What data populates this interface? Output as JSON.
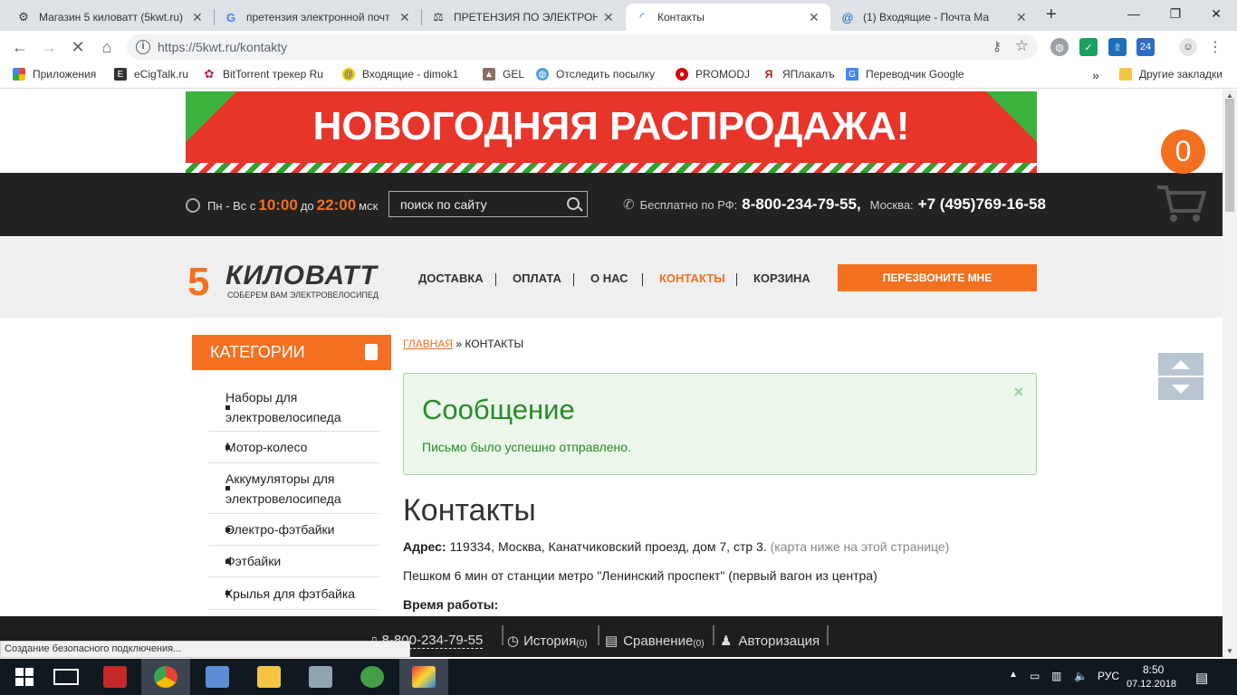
{
  "browser": {
    "tabs": [
      {
        "title": "Магазин 5 киловатт (5kwt.ru)",
        "icon": "film-icon"
      },
      {
        "title": "претензия электронной почт",
        "icon": "google-icon"
      },
      {
        "title": "ПРЕТЕНЗИЯ ПО ЭЛЕКТРОННО",
        "icon": "scales-icon"
      },
      {
        "title": "Контакты",
        "icon": "loading-icon"
      },
      {
        "title": "(1) Входящие - Почта Ма",
        "icon": "mail-at-icon"
      }
    ],
    "new_tab": "+",
    "url": "https://5kwt.ru/kontakty",
    "bookmarks": [
      {
        "label": "Приложения",
        "icon": "apps-grid-icon"
      },
      {
        "label": "eCigTalk.ru",
        "icon": "e-icon"
      },
      {
        "label": "BitTorrent трекер Ru",
        "icon": "flower-icon"
      },
      {
        "label": "Входящие - dimok1",
        "icon": "mail-at-icon"
      },
      {
        "label": "GEL",
        "icon": "gel-icon"
      },
      {
        "label": "Отследить посылку",
        "icon": "globe-icon"
      },
      {
        "label": "PROMODJ",
        "icon": "promodj-icon"
      },
      {
        "label": "ЯПлакалъ",
        "icon": "yaplakal-icon"
      },
      {
        "label": "Переводчик Google",
        "icon": "translate-icon"
      }
    ],
    "bookmarks_more": "»",
    "other_bookmarks": "Другие закладки",
    "ext_badge": "24"
  },
  "banner": {
    "text": "НОВОГОДНЯЯ РАСПРОДАЖА!"
  },
  "topbar": {
    "hours_prefix": "Пн - Вс с",
    "open_time": "10:00",
    "hours_mid": "до",
    "close_time": "22:00",
    "hours_suffix": "мск",
    "search_placeholder": "поиск по сайту",
    "free_label": "Бесплатно по РФ:",
    "free_phone": "8-800-234-79-55,",
    "moscow_label": "Москва:",
    "moscow_phone": "+7 (495)769-16-58",
    "cart_count": "0"
  },
  "logo": {
    "digit": "5",
    "name": "КИЛОВАТТ",
    "tagline": "СОБЕРЕМ ВАМ ЭЛЕКТРОВЕЛОСИПЕД"
  },
  "menu": {
    "items": [
      "ДОСТАВКА",
      "ОПЛАТА",
      "О НАС",
      "КОНТАКТЫ",
      "КОРЗИНА"
    ],
    "active": "КОНТАКТЫ",
    "callback": "ПЕРЕЗВОНИТЕ МНЕ"
  },
  "sidebar": {
    "title": "КАТЕГОРИИ",
    "items": [
      "Наборы для электровелосипеда",
      "Мотор-колесо",
      "Аккумуляторы для электровелосипеда",
      "Электро-фэтбайки",
      "Фэтбайки",
      "Крылья для фэтбайка"
    ]
  },
  "breadcrumb": {
    "home": "ГЛАВНАЯ",
    "sep": "»",
    "current": "КОНТАКТЫ"
  },
  "message": {
    "title": "Сообщение",
    "text": "Письмо было успешно отправлено.",
    "close": "×"
  },
  "content": {
    "title": "Контакты",
    "address_label": "Адрес:",
    "address": "119334, Москва, Канатчиковский проезд, дом 7, стр 3.",
    "address_note": "(карта ниже на этой странице)",
    "walk": "Пешком 6 мин от станции метро \"Ленинский проспект\" (первый вагон из центра)",
    "hours_label": "Время работы:"
  },
  "bottombar": {
    "phone": "8-800-234-79-55",
    "history": "История",
    "history_count": "(0)",
    "compare": "Сравнение",
    "compare_count": "(0)",
    "auth": "Авторизация"
  },
  "status_text": "Создание безопасного подключения...",
  "taskbar": {
    "lang": "РУС",
    "time": "8:50",
    "date": "07.12.2018"
  },
  "colors": {
    "accent": "#f37021",
    "dark": "#222222",
    "success": "#2a8a2a"
  }
}
